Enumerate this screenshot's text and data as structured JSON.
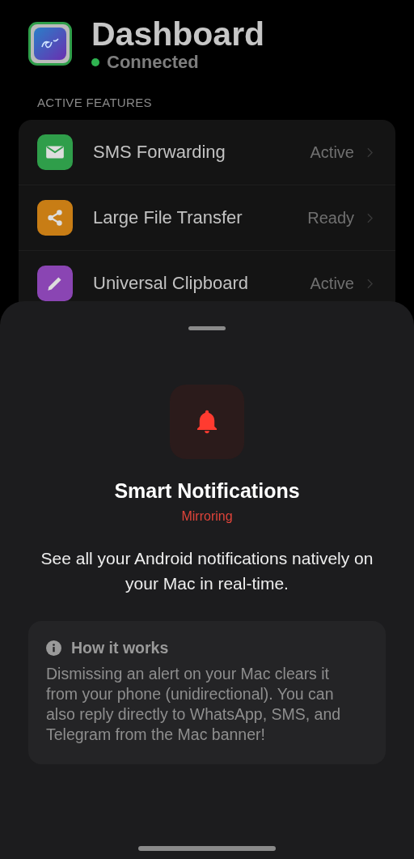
{
  "header": {
    "title": "Dashboard",
    "status": {
      "text": "Connected",
      "connected": true
    }
  },
  "section_title": "ACTIVE FEATURES",
  "features": [
    {
      "name": "SMS Forwarding",
      "status": "Active",
      "kind": "mail",
      "color": "#2f9e4a"
    },
    {
      "name": "Large File Transfer",
      "status": "Ready",
      "kind": "share",
      "color": "#c87d15"
    },
    {
      "name": "Universal Clipboard",
      "status": "Active",
      "kind": "pencil",
      "color": "#8a45b3"
    }
  ],
  "sheet": {
    "title": "Smart Notifications",
    "subtitle": "Mirroring",
    "description": "See all your Android notifications natively on your Mac in real-time.",
    "info": {
      "title": "How it works",
      "body": "Dismissing an alert on your Mac clears it from your phone (unidirectional). You can also reply directly to WhatsApp, SMS, and Telegram from the Mac banner!"
    }
  }
}
